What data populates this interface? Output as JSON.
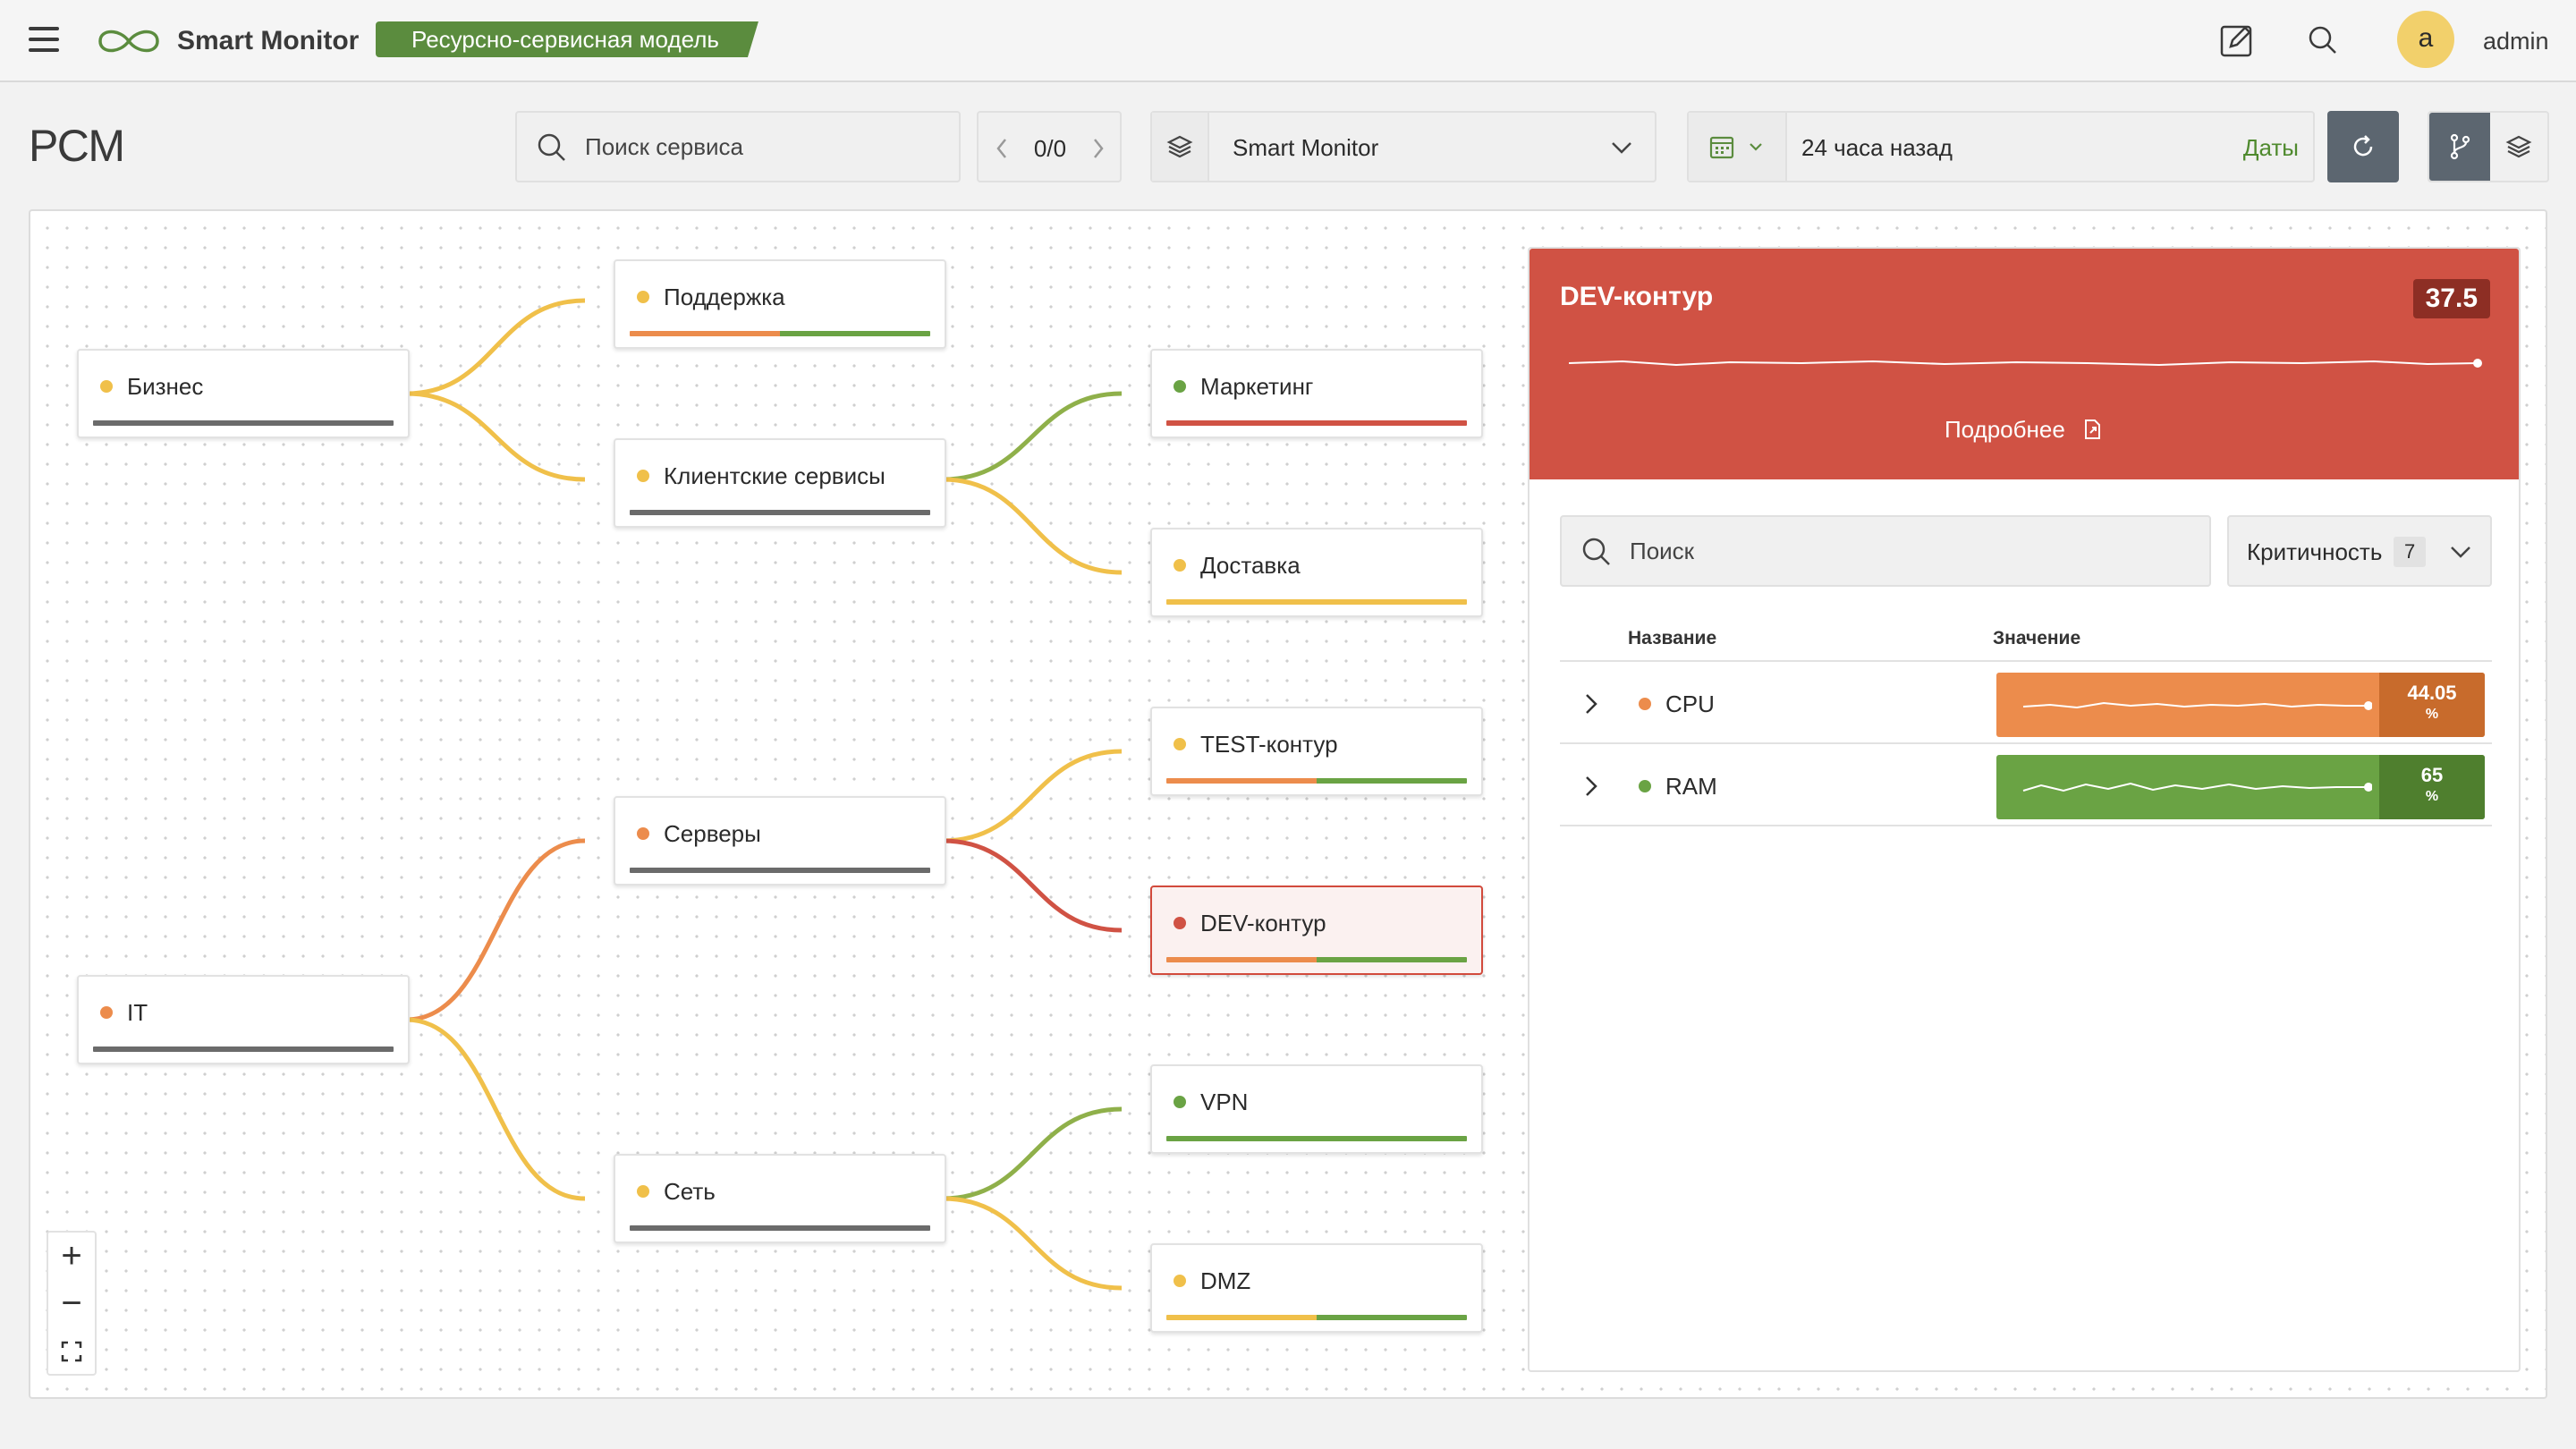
{
  "header": {
    "app_name": "Smart Monitor",
    "module_badge": "Ресурсно-сервисная модель",
    "user_initial": "a",
    "username": "admin"
  },
  "toolbar": {
    "page_title": "РСМ",
    "search_placeholder": "Поиск сервиса",
    "pager_count": "0/0",
    "layer_value": "Smart Monitor",
    "date_value": "24 часа назад",
    "dates_link": "Даты"
  },
  "colors": {
    "yellow": "#f0c04a",
    "orange": "#ec8c4c",
    "green": "#6aa344",
    "red": "#d05244",
    "gray": "#6b6b6b",
    "brand_green": "#5b8c3e"
  },
  "tree": {
    "nodes": [
      {
        "id": "biz",
        "label": "Бизнес",
        "status": "yellow"
      },
      {
        "id": "support",
        "label": "Поддержка",
        "status": "yellow"
      },
      {
        "id": "clients",
        "label": "Клиентские сервисы",
        "status": "yellow"
      },
      {
        "id": "marketing",
        "label": "Маркетинг",
        "status": "green"
      },
      {
        "id": "delivery",
        "label": "Доставка",
        "status": "yellow"
      },
      {
        "id": "test",
        "label": "TEST-контур",
        "status": "yellow"
      },
      {
        "id": "servers",
        "label": "Серверы",
        "status": "orange"
      },
      {
        "id": "dev",
        "label": "DEV-контур",
        "status": "red",
        "selected": true
      },
      {
        "id": "it",
        "label": "IT",
        "status": "orange"
      },
      {
        "id": "vpn",
        "label": "VPN",
        "status": "green"
      },
      {
        "id": "net",
        "label": "Сеть",
        "status": "yellow"
      },
      {
        "id": "dmz",
        "label": "DMZ",
        "status": "yellow"
      }
    ]
  },
  "zoom": {
    "in": "+",
    "out": "−"
  },
  "detail": {
    "title": "DEV-контур",
    "score": "37.5",
    "more_link": "Подробнее",
    "search_placeholder": "Поиск",
    "filter_label": "Критичность",
    "filter_count": "7",
    "columns": {
      "name": "Название",
      "value": "Значение"
    },
    "rows": [
      {
        "name": "CPU",
        "status": "orange",
        "value": "44.05",
        "unit": "%"
      },
      {
        "name": "RAM",
        "status": "green",
        "value": "65",
        "unit": "%"
      }
    ]
  }
}
